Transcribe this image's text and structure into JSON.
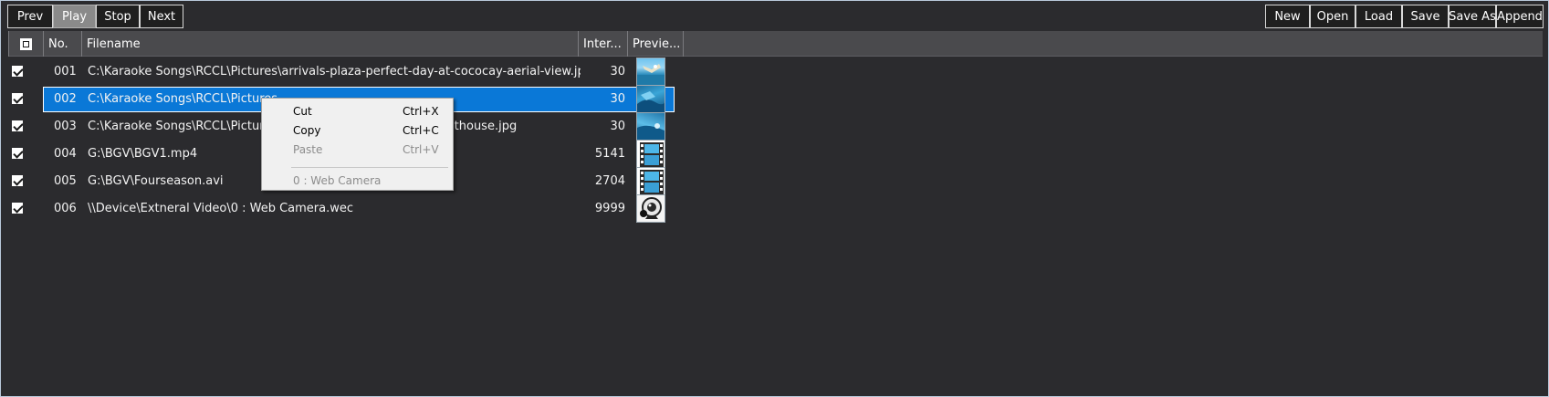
{
  "toolbar": {
    "left": [
      {
        "label": "Prev"
      },
      {
        "label": "Play"
      },
      {
        "label": "Stop"
      },
      {
        "label": "Next"
      }
    ],
    "right": [
      {
        "label": "New"
      },
      {
        "label": "Open"
      },
      {
        "label": "Load"
      },
      {
        "label": "Save"
      },
      {
        "label": "Save As"
      },
      {
        "label": "Append"
      }
    ]
  },
  "columns": {
    "no": "No.",
    "filename": "Filename",
    "interval": "Inter...",
    "preview": "Previe..."
  },
  "rows": [
    {
      "no": "001",
      "filename": "C:\\Karaoke Songs\\RCCL\\Pictures\\arrivals-plaza-perfect-day-at-cococay-aerial-view.jpg",
      "interval": "30",
      "checked": true,
      "selected": false,
      "preview_icon": "photo-thumbnail-icon"
    },
    {
      "no": "002",
      "filename": "C:\\Karaoke Songs\\RCCL\\Pictures",
      "interval": "30",
      "checked": true,
      "selected": true,
      "preview_icon": "photo-thumbnail-icon"
    },
    {
      "no": "003",
      "filename": "C:\\Karaoke Songs\\RCCL\\Pictures",
      "filename_tail": "d-lighthouse.jpg",
      "interval": "30",
      "checked": true,
      "selected": false,
      "preview_icon": "photo-thumbnail-icon"
    },
    {
      "no": "004",
      "filename": "G:\\BGV\\BGV1.mp4",
      "interval": "5141",
      "checked": true,
      "selected": false,
      "preview_icon": "video-file-icon"
    },
    {
      "no": "005",
      "filename": "G:\\BGV\\Fourseason.avi",
      "interval": "2704",
      "checked": true,
      "selected": false,
      "preview_icon": "video-file-icon"
    },
    {
      "no": "006",
      "filename": "\\\\Device\\Extneral Video\\0 : Web Camera.wec",
      "interval": "9999",
      "checked": true,
      "selected": false,
      "preview_icon": "webcam-icon"
    }
  ],
  "context_menu": {
    "items": [
      {
        "label": "Cut",
        "shortcut": "Ctrl+X",
        "enabled": true
      },
      {
        "label": "Copy",
        "shortcut": "Ctrl+C",
        "enabled": true
      },
      {
        "label": "Paste",
        "shortcut": "Ctrl+V",
        "enabled": false
      },
      {
        "label": "0 : Web Camera",
        "shortcut": "",
        "enabled": false
      }
    ]
  },
  "colors": {
    "background": "#2b2b2e",
    "header": "#4a4a4d",
    "selection": "#0a78d7",
    "menu": "#f0f0f0"
  }
}
